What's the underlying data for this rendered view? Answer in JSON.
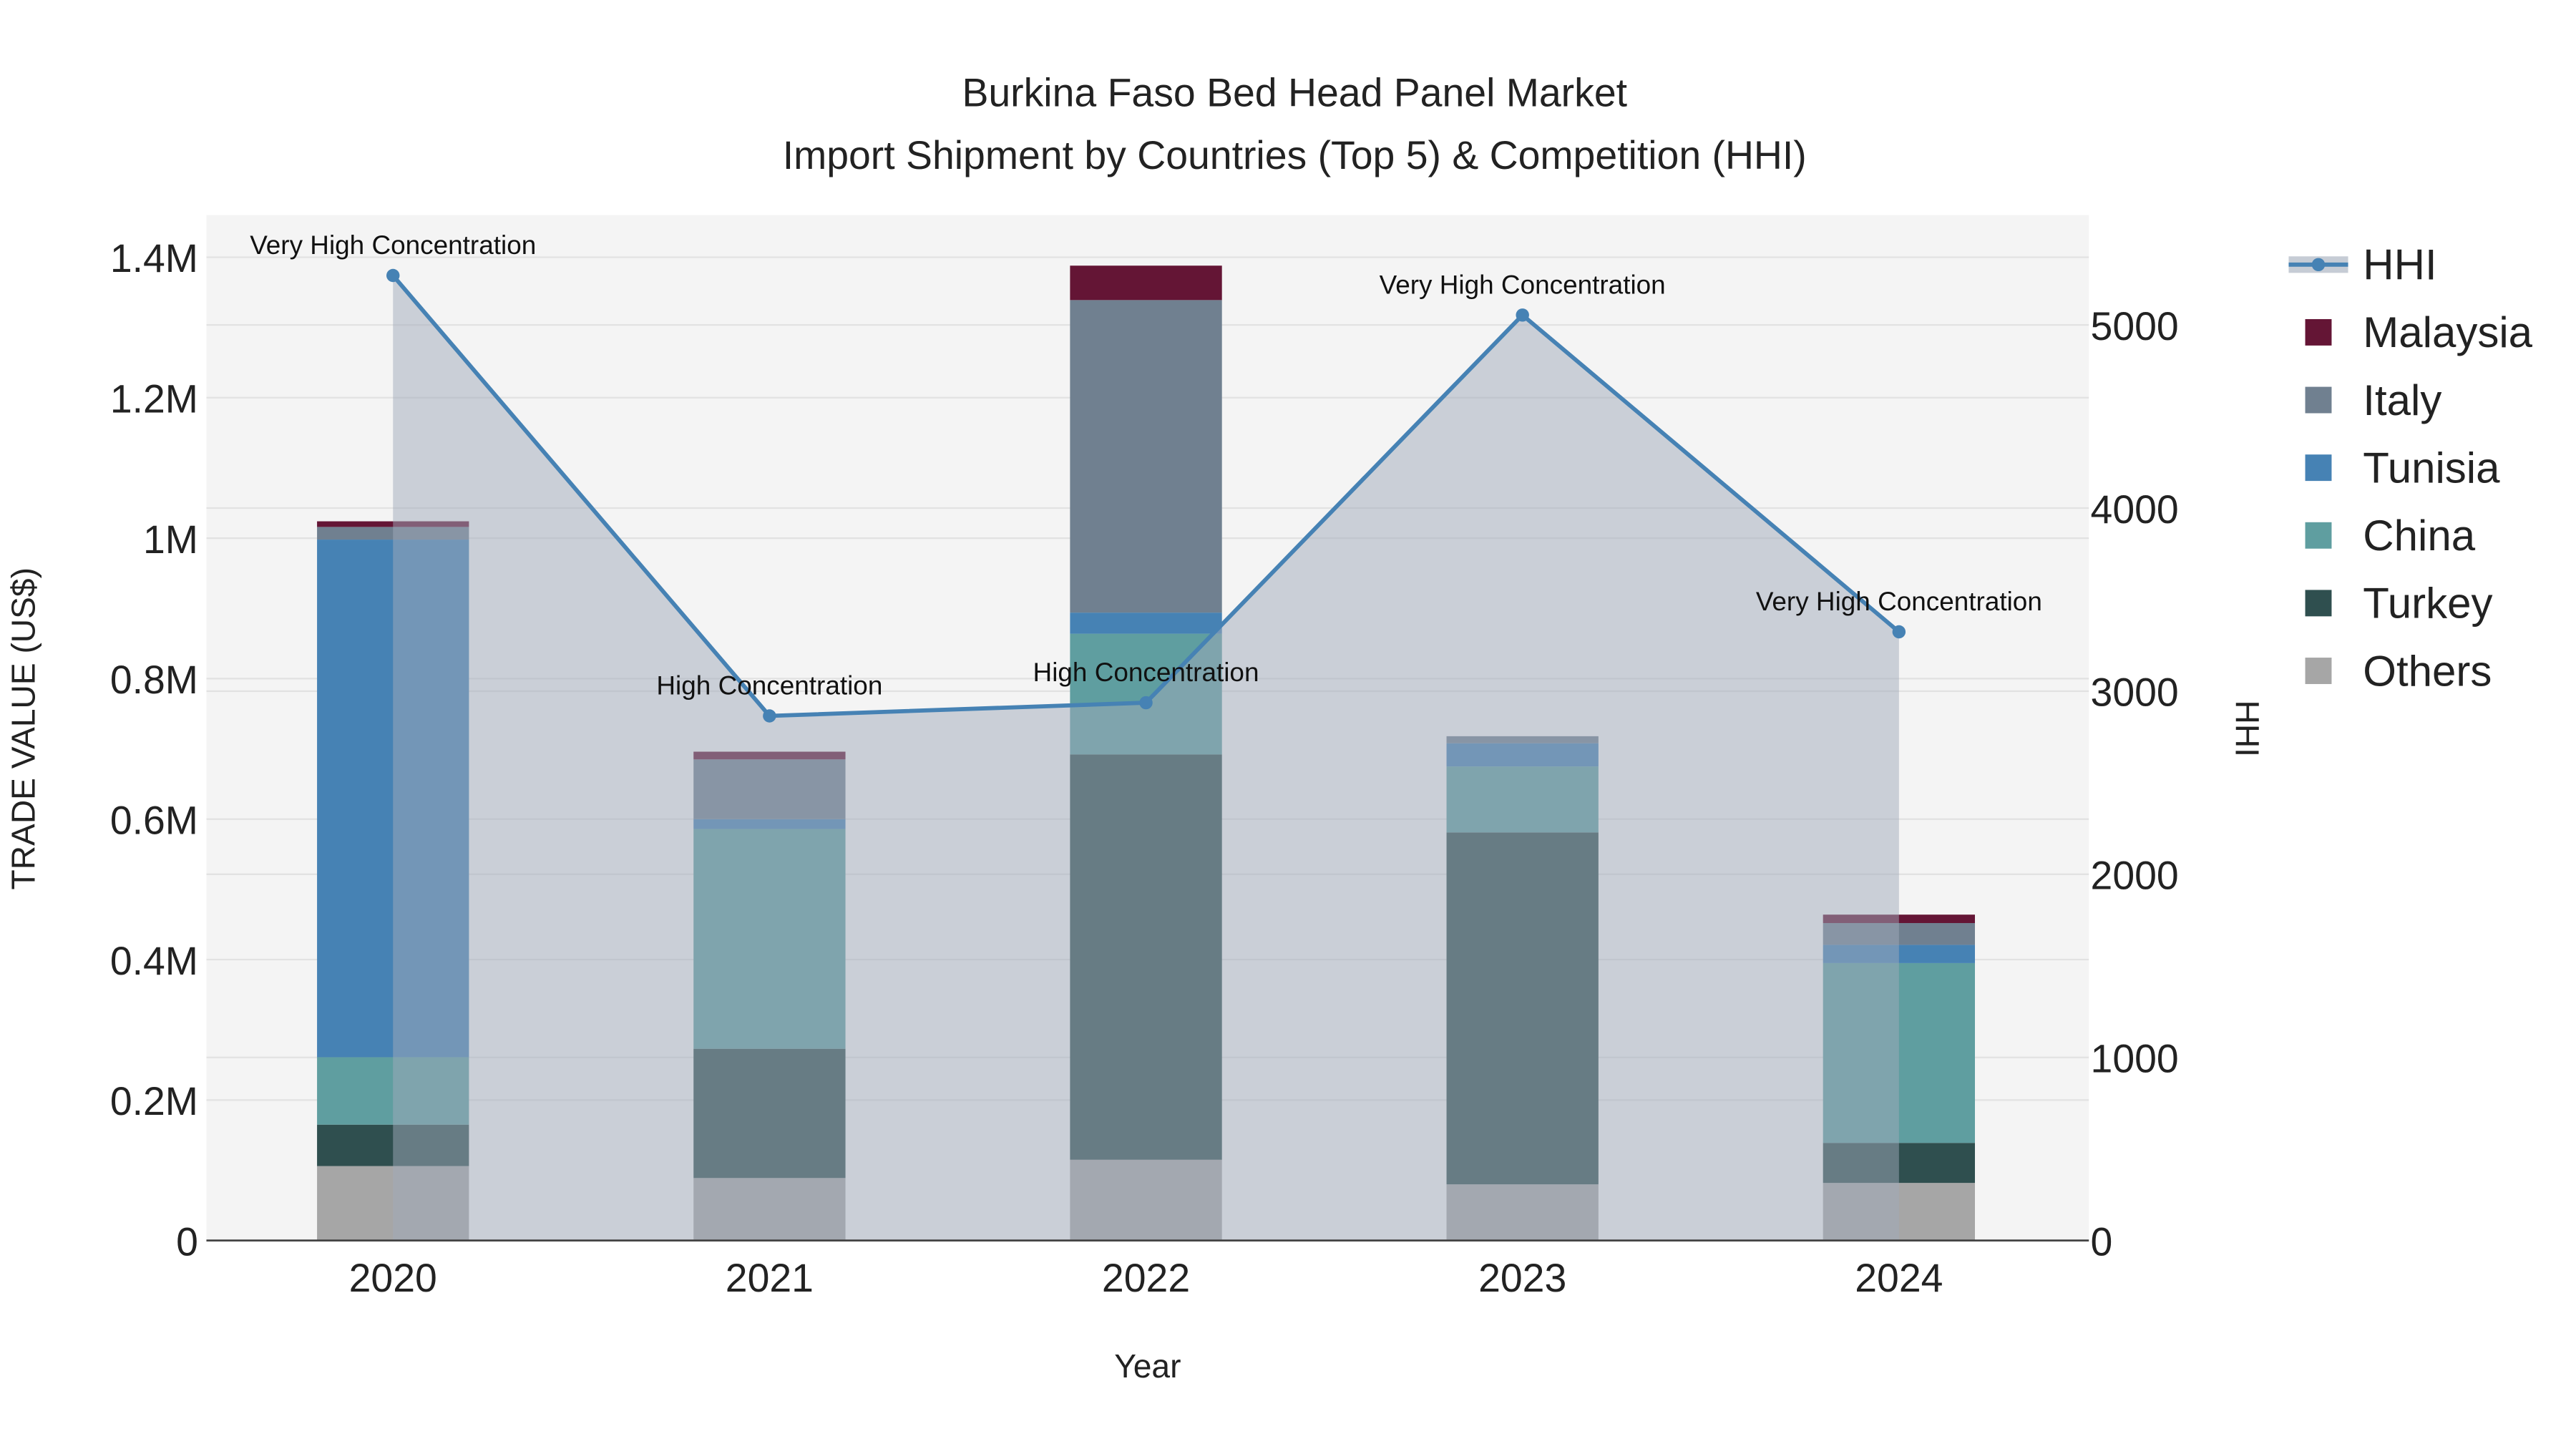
{
  "chart_data": {
    "type": "bar",
    "title": "Burkina Faso Bed Head Panel Market",
    "subtitle": "Import Shipment by Countries (Top 5) & Competition (HHI)",
    "xlabel": "Year",
    "ylabel": "TRADE VALUE (US$)",
    "y2label": "HHI",
    "categories": [
      "2020",
      "2021",
      "2022",
      "2023",
      "2024"
    ],
    "ylim": [
      0,
      1460000
    ],
    "y2lim": [
      0,
      5600
    ],
    "yticks": [
      0,
      200000,
      400000,
      600000,
      800000,
      1000000,
      1200000,
      1400000
    ],
    "ytick_labels": [
      "0",
      "0.2M",
      "0.4M",
      "0.6M",
      "0.8M",
      "1M",
      "1.2M",
      "1.4M"
    ],
    "y2ticks": [
      0,
      1000,
      2000,
      3000,
      4000,
      5000
    ],
    "y2tick_labels": [
      "0",
      "1000",
      "2000",
      "3000",
      "4000",
      "5000"
    ],
    "stacked": true,
    "series": [
      {
        "name": "Others",
        "color": "#a6a6a6",
        "values": [
          106000,
          89000,
          115000,
          80000,
          82000
        ]
      },
      {
        "name": "Turkey",
        "color": "#2f4f4f",
        "values": [
          59000,
          184000,
          577000,
          501000,
          57000
        ]
      },
      {
        "name": "China",
        "color": "#5f9ea0",
        "values": [
          96000,
          313000,
          172000,
          94000,
          256000
        ]
      },
      {
        "name": "Tunisia",
        "color": "#4682b4",
        "values": [
          737000,
          14000,
          30000,
          33000,
          26000
        ]
      },
      {
        "name": "Italy",
        "color": "#708090",
        "values": [
          18000,
          85000,
          445000,
          10000,
          31000
        ]
      },
      {
        "name": "Malaysia",
        "color": "#641535",
        "values": [
          8000,
          11000,
          49000,
          0,
          12000
        ]
      }
    ],
    "hhi": {
      "name": "HHI",
      "color": "#4682b4",
      "values": [
        5270,
        2865,
        2937,
        5054,
        3324
      ],
      "annotations": [
        "Very High Concentration",
        "High Concentration",
        "High Concentration",
        "Very High Concentration",
        "Very High Concentration"
      ]
    },
    "legend": [
      "HHI",
      "Malaysia",
      "Italy",
      "Tunisia",
      "China",
      "Turkey",
      "Others"
    ],
    "legend_position": "right",
    "grid": true
  }
}
